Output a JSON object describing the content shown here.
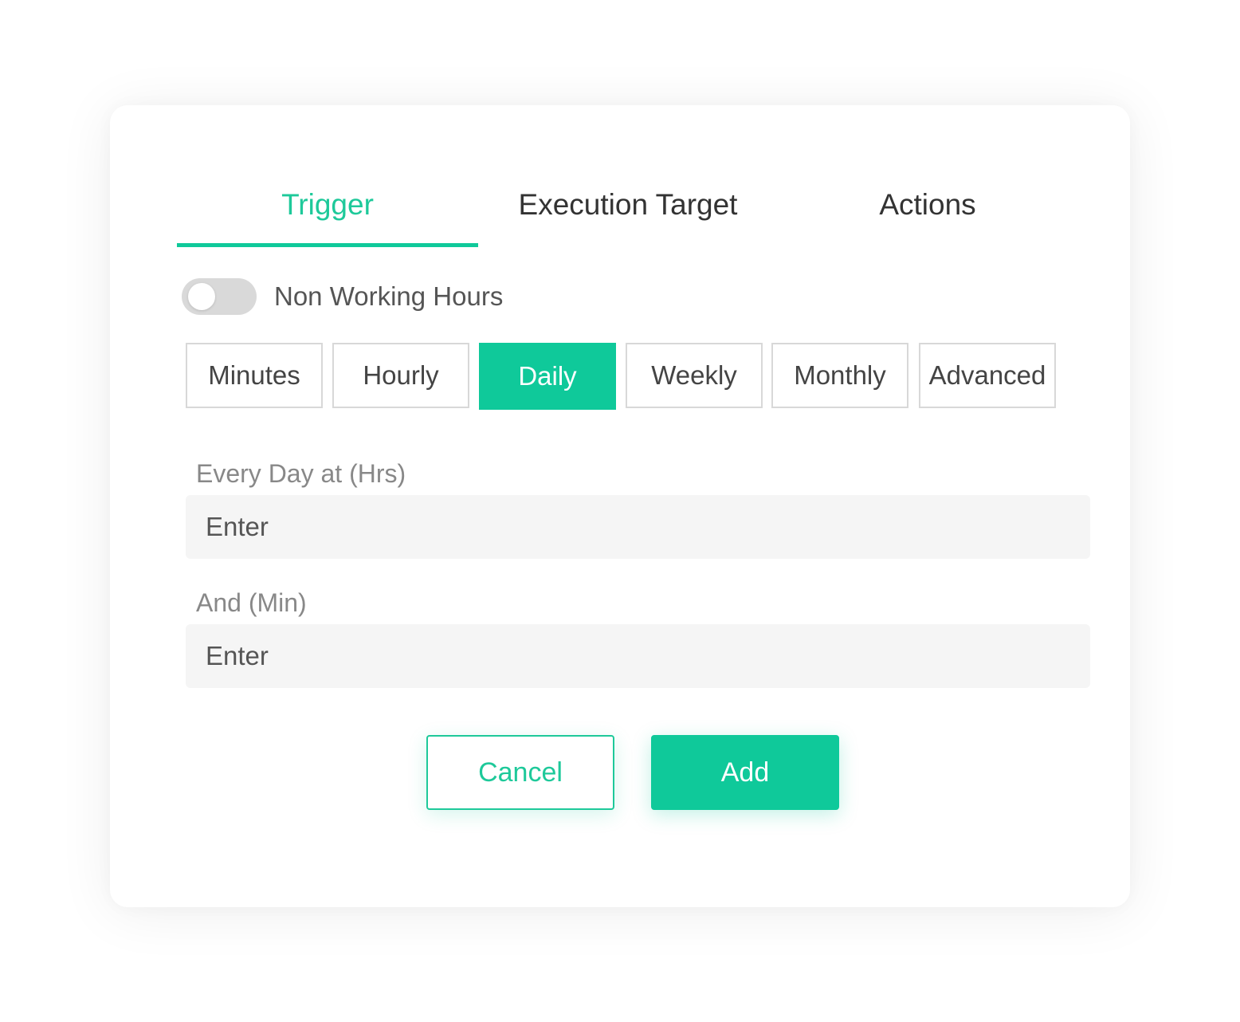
{
  "tabs": [
    {
      "label": "Trigger",
      "active": true
    },
    {
      "label": "Execution Target",
      "active": false
    },
    {
      "label": "Actions",
      "active": false
    }
  ],
  "toggle": {
    "label": "Non Working Hours",
    "on": false
  },
  "frequency": {
    "options": [
      "Minutes",
      "Hourly",
      "Daily",
      "Weekly",
      "Monthly",
      "Advanced"
    ],
    "selected": "Daily"
  },
  "fields": {
    "hours": {
      "label": "Every Day at (Hrs)",
      "placeholder": "Enter",
      "value": ""
    },
    "minutes": {
      "label": "And (Min)",
      "placeholder": "Enter",
      "value": ""
    }
  },
  "buttons": {
    "cancel": "Cancel",
    "add": "Add"
  },
  "colors": {
    "accent": "#0fc99a",
    "accent_text": "#1ec99a",
    "input_bg": "#f5f5f5",
    "toggle_off": "#d9d9d9"
  }
}
